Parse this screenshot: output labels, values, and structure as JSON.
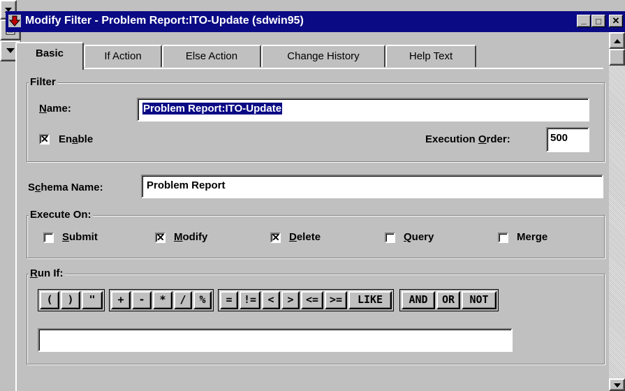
{
  "window": {
    "title": "Modify Filter - Problem Report:ITO-Update (sdwin95)",
    "buttons": {
      "minimize": "_",
      "maximize": "□",
      "close": "✕"
    }
  },
  "tabs": [
    {
      "label": "Basic",
      "active": true
    },
    {
      "label": "If Action"
    },
    {
      "label": "Else Action"
    },
    {
      "label": "Change History"
    },
    {
      "label": "Help Text"
    }
  ],
  "filter": {
    "group_label": "Filter",
    "name_label": "Name:",
    "name_value": "Problem Report:ITO-Update",
    "enable_label": "Enable",
    "enable_checked": true,
    "exec_order_label": "Execution Order:",
    "exec_order_value": "500"
  },
  "schema": {
    "label": "Schema Name:",
    "value": "Problem Report"
  },
  "execute_on": {
    "group_label": "Execute On:",
    "options": [
      {
        "label": "Submit",
        "checked": false
      },
      {
        "label": "Modify",
        "checked": true
      },
      {
        "label": "Delete",
        "checked": true
      },
      {
        "label": "Query",
        "checked": false
      },
      {
        "label": "Merge",
        "checked": false
      }
    ]
  },
  "run_if": {
    "group_label": "Run If:",
    "operators": [
      "(",
      ")",
      "\"",
      "+",
      "-",
      "*",
      "/",
      "%",
      "=",
      "!=",
      "<",
      ">",
      "<=",
      ">=",
      "LIKE",
      "AND",
      "OR",
      "NOT"
    ],
    "expression": ""
  },
  "icons": {
    "app_icon": "arrow-app-icon",
    "field_list": "document-icon",
    "dropdown": "triangle-down-icon"
  }
}
